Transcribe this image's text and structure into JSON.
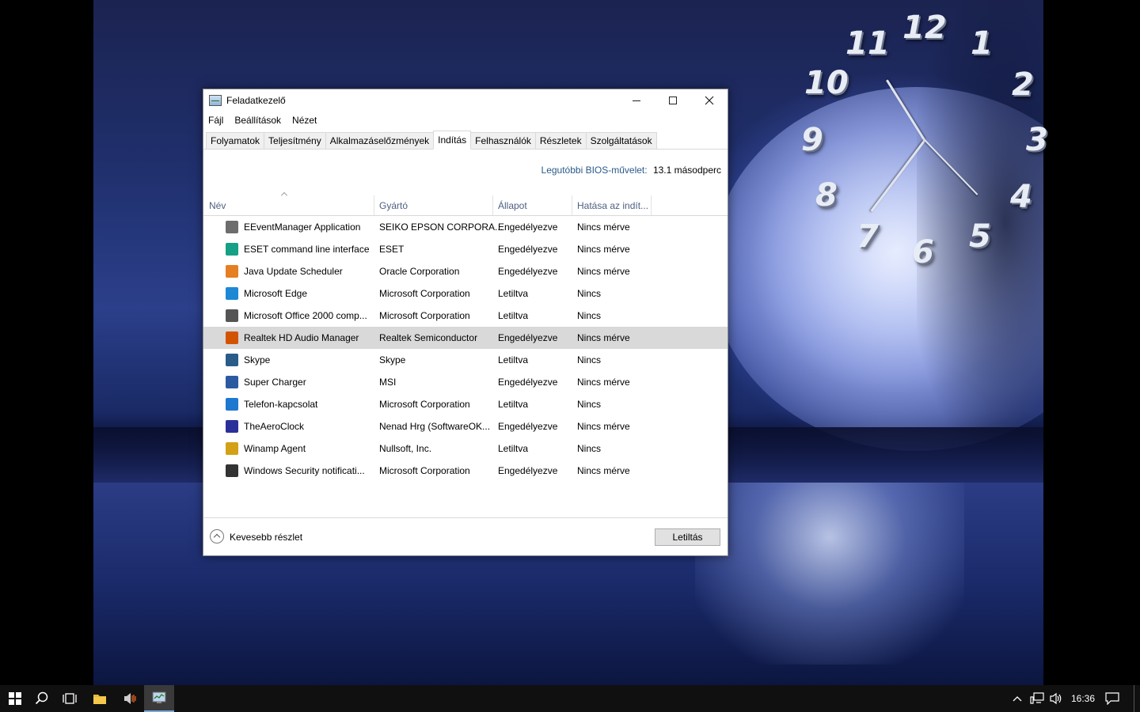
{
  "window": {
    "title": "Feladatkezelő",
    "menu": [
      "Fájl",
      "Beállítások",
      "Nézet"
    ],
    "tabs": [
      "Folyamatok",
      "Teljesítmény",
      "Alkalmazáselőzmények",
      "Indítás",
      "Felhasználók",
      "Részletek",
      "Szolgáltatások"
    ],
    "active_tab": "Indítás",
    "bios_label": "Legutóbbi BIOS-művelet:",
    "bios_value": "13.1 másodperc",
    "columns": [
      "Név",
      "Gyártó",
      "Állapot",
      "Hatása az indít..."
    ],
    "rows": [
      {
        "name": "EEventManager Application",
        "vendor": "SEIKO EPSON CORPORA...",
        "status": "Engedélyezve",
        "impact": "Nincs mérve",
        "icon": "epson-icon",
        "color": "#6d6d6d"
      },
      {
        "name": "ESET command line interface",
        "vendor": "ESET",
        "status": "Engedélyezve",
        "impact": "Nincs mérve",
        "icon": "eset-icon",
        "color": "#16a085"
      },
      {
        "name": "Java Update Scheduler",
        "vendor": "Oracle Corporation",
        "status": "Engedélyezve",
        "impact": "Nincs mérve",
        "icon": "java-icon",
        "color": "#e67e22"
      },
      {
        "name": "Microsoft Edge",
        "vendor": "Microsoft Corporation",
        "status": "Letiltva",
        "impact": "Nincs",
        "icon": "edge-icon",
        "color": "#1e88d4"
      },
      {
        "name": "Microsoft Office 2000 comp...",
        "vendor": "Microsoft Corporation",
        "status": "Letiltva",
        "impact": "Nincs",
        "icon": "office-icon",
        "color": "#555555"
      },
      {
        "name": "Realtek HD Audio Manager",
        "vendor": "Realtek Semiconductor",
        "status": "Engedélyezve",
        "impact": "Nincs mérve",
        "icon": "realtek-icon",
        "color": "#d35400"
      },
      {
        "name": "Skype",
        "vendor": "Skype",
        "status": "Letiltva",
        "impact": "Nincs",
        "icon": "skype-icon",
        "color": "#2a5c8a"
      },
      {
        "name": "Super Charger",
        "vendor": "MSI",
        "status": "Engedélyezve",
        "impact": "Nincs mérve",
        "icon": "supercharger-icon",
        "color": "#2c5aa0"
      },
      {
        "name": "Telefon-kapcsolat",
        "vendor": "Microsoft Corporation",
        "status": "Letiltva",
        "impact": "Nincs",
        "icon": "phone-link-icon",
        "color": "#1e78d0"
      },
      {
        "name": "TheAeroClock",
        "vendor": "Nenad Hrg (SoftwareOK...",
        "status": "Engedélyezve",
        "impact": "Nincs mérve",
        "icon": "clock-icon",
        "color": "#2b2f9a"
      },
      {
        "name": "Winamp Agent",
        "vendor": "Nullsoft, Inc.",
        "status": "Letiltva",
        "impact": "Nincs",
        "icon": "winamp-icon",
        "color": "#d4a017"
      },
      {
        "name": "Windows Security notificati...",
        "vendor": "Microsoft Corporation",
        "status": "Engedélyezve",
        "impact": "Nincs mérve",
        "icon": "shield-icon",
        "color": "#333333"
      }
    ],
    "selected_row": 5,
    "less_details": "Kevesebb részlet",
    "disable_button": "Letiltás"
  },
  "clock": {
    "numbers": [
      "12",
      "1",
      "2",
      "3",
      "4",
      "5",
      "6",
      "7",
      "8",
      "9",
      "10",
      "11"
    ]
  },
  "taskbar": {
    "time": "16:36"
  }
}
